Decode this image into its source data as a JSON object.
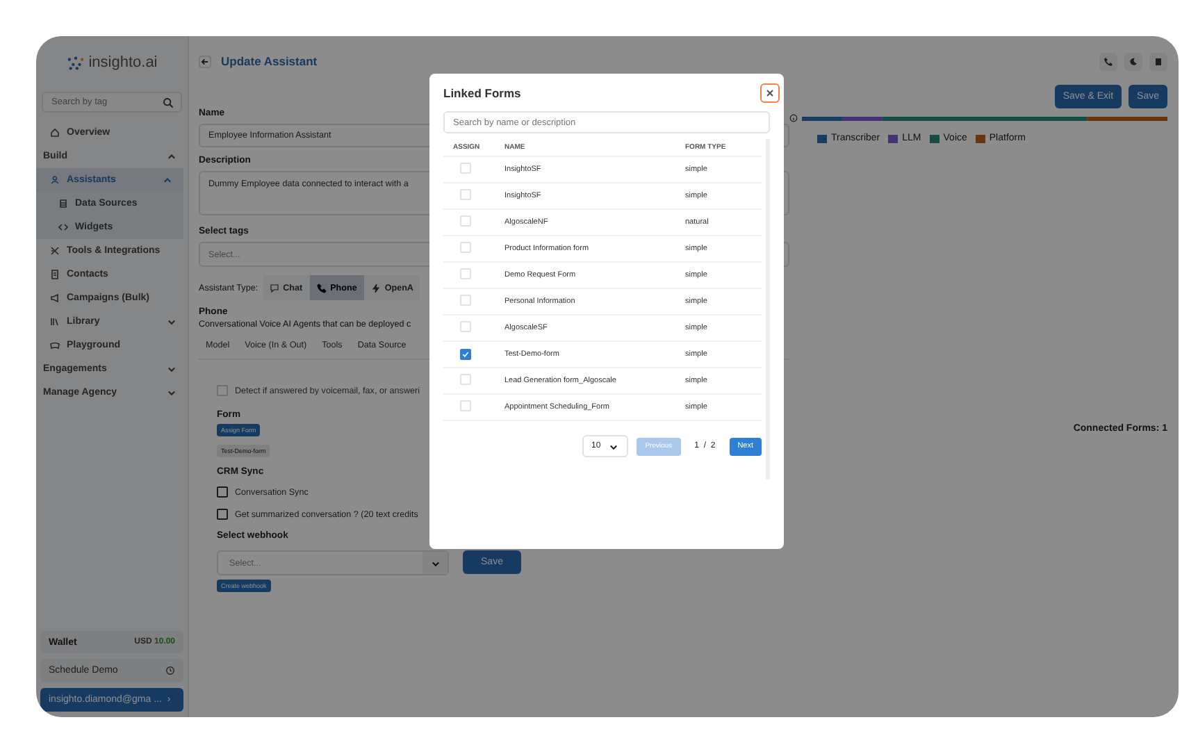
{
  "sidebar": {
    "logo": "insighto.ai",
    "search": {
      "placeholder": "Search by tag"
    },
    "items": [
      {
        "label": "Overview",
        "selected": false
      },
      {
        "label": "Build",
        "kind": "section",
        "expanded": true,
        "children": [
          {
            "label": "Assistants",
            "expanded": true,
            "selected": true,
            "children": [
              {
                "label": "Data Sources",
                "selected": false
              },
              {
                "label": "Widgets",
                "selected": false
              }
            ]
          },
          {
            "label": "Tools & Integrations",
            "selected": false
          },
          {
            "label": "Contacts",
            "selected": false
          },
          {
            "label": "Campaigns (Bulk)",
            "selected": false
          },
          {
            "label": "Library",
            "expanded": false,
            "selected": false
          },
          {
            "label": "Playground",
            "selected": false
          }
        ]
      },
      {
        "label": "Engagements",
        "kind": "section",
        "expanded": false
      },
      {
        "label": "Manage Agency",
        "kind": "section",
        "expanded": false
      }
    ],
    "wallet": {
      "label": "Wallet",
      "currency": "USD",
      "amount": "10.00"
    },
    "schedule": "Schedule Demo",
    "user": "insighto.diamond@gma ...",
    "user_arrow": "›"
  },
  "header": {
    "title": "Update Assistant"
  },
  "form": {
    "name_label": "Name",
    "name_value": "Employee Information Assistant",
    "description_label": "Description",
    "description_value": "Dummy Employee data connected to interact with a",
    "tags_label": "Select tags",
    "tags_placeholder": "Select...",
    "type_label": "Assistant Type:",
    "types": [
      {
        "label": "Chat",
        "selected": false
      },
      {
        "label": "Phone",
        "selected": true
      },
      {
        "label": "OpenA",
        "selected": false
      }
    ],
    "type_title": "Phone",
    "type_description": "Conversational Voice AI Agents that can be deployed c",
    "tabs": [
      {
        "label": "Model",
        "selected": false
      },
      {
        "label": "Voice (In & Out)",
        "selected": false
      },
      {
        "label": "Tools",
        "selected": false
      },
      {
        "label": "Data Source",
        "selected": false
      }
    ],
    "detect": {
      "label": "Detect if answered by voicemail, fax, or answeri",
      "checked": false
    },
    "form_label": "Form",
    "assign_button": "Assign Form",
    "assigned_form": "Test-Demo-form",
    "crm_label": "CRM Sync",
    "crm_options": [
      {
        "label": "Conversation Sync",
        "checked": false
      },
      {
        "label": "Get summarized conversation ? (20 text credits",
        "checked": false
      }
    ],
    "webhook_label": "Select webhook",
    "webhook_placeholder": "Select...",
    "save_button": "Save",
    "create_webhook": "Create webhook"
  },
  "actions": [
    "Save & Exit",
    "Save"
  ],
  "cost": {
    "segments": [
      {
        "name": "Transcriber",
        "color": "#183b61"
      },
      {
        "name": "LLM",
        "color": "#463275"
      },
      {
        "name": "Voice",
        "color": "#184d44"
      },
      {
        "name": "Platform",
        "color": "#6a3611"
      }
    ]
  },
  "connected_forms": "Connected Forms: 1",
  "modal": {
    "title": "Linked Forms",
    "search_placeholder": "Search by name or description",
    "columns": [
      "ASSIGN",
      "NAME",
      "FORM TYPE"
    ],
    "rows": [
      {
        "name": "InsightoSF",
        "type": "simple",
        "checked": false
      },
      {
        "name": "InsightoSF",
        "type": "simple",
        "checked": false
      },
      {
        "name": "AlgoscaleNF",
        "type": "natural",
        "checked": false
      },
      {
        "name": "Product Information form",
        "type": "simple",
        "checked": false
      },
      {
        "name": "Demo Request Form",
        "type": "simple",
        "checked": false
      },
      {
        "name": "Personal Information",
        "type": "simple",
        "checked": false
      },
      {
        "name": "AlgoscaleSF",
        "type": "simple",
        "checked": false
      },
      {
        "name": "Test-Demo-form",
        "type": "simple",
        "checked": true
      },
      {
        "name": "Lead Generation form_Algoscale",
        "type": "simple",
        "checked": false
      },
      {
        "name": "Appointment Scheduling_Form",
        "type": "simple",
        "checked": false
      }
    ],
    "page_size": "10",
    "previous": "Previous",
    "previous_disabled": true,
    "page": "1",
    "page_sep": "/",
    "pages": "2",
    "next": "Next"
  }
}
